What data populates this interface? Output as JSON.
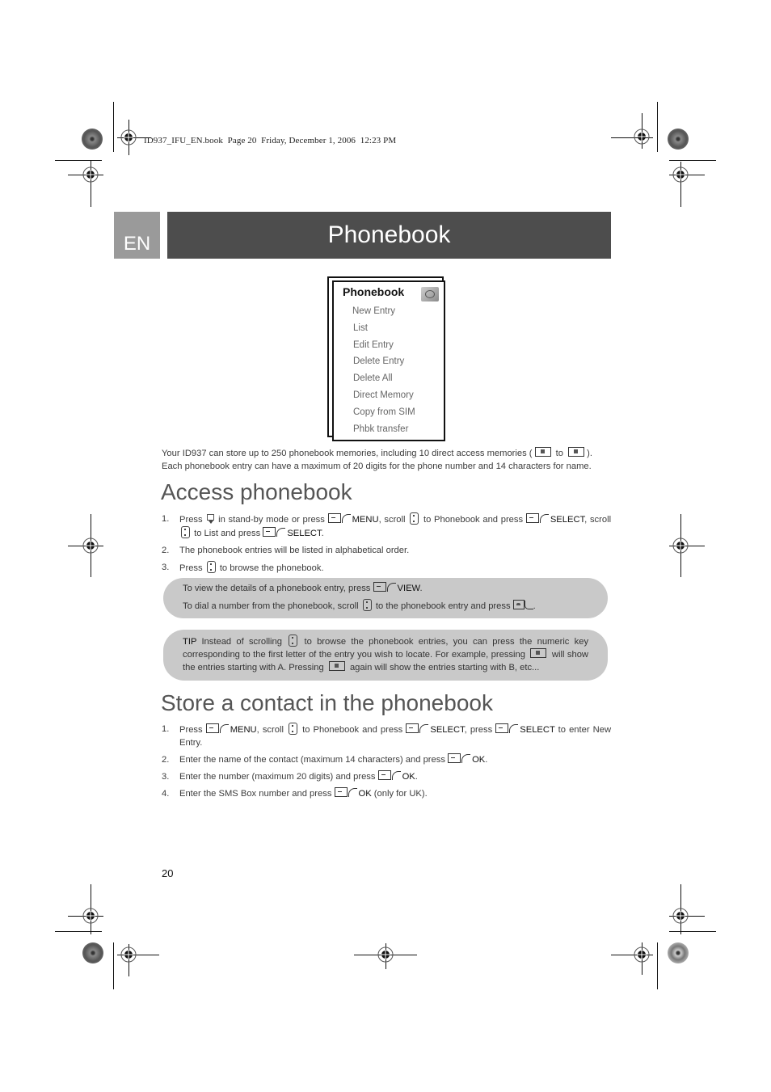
{
  "print_header": {
    "text": "ID937_IFU_EN.book  Page 20  Friday, December 1, 2006  12:23 PM"
  },
  "header": {
    "language_tab": "EN",
    "title": "Phonebook"
  },
  "phone_menu": {
    "title": "Phonebook",
    "icon": "phonebook-icon",
    "items": [
      "New Entry",
      "List",
      "Edit Entry",
      "Delete Entry",
      "Delete All",
      "Direct Memory",
      "Copy from SIM",
      "Phbk transfer"
    ]
  },
  "intro": {
    "line1_a": "Your ID937 can store up to 250 phonebook memories, including 10 direct access memories (",
    "line1_to": "to",
    "line1_b": ").",
    "line2": "Each phonebook entry can have a maximum of 20 digits for the phone number and 14 characters for name."
  },
  "access": {
    "heading": "Access phonebook",
    "steps": [
      {
        "num": "1.",
        "parts": {
          "a": "Press",
          "b": "in stand-by mode or press",
          "menu": "MENU",
          "c": ", scroll",
          "d": "to Phonebook and press",
          "select1": "SELECT",
          "e": ", scroll",
          "f": "to List and press",
          "select2": "SELECT",
          "g": "."
        }
      },
      {
        "num": "2.",
        "text": "The phonebook entries will be listed in alphabetical order."
      },
      {
        "num": "3.",
        "a": "Press",
        "b": "to browse the phonebook."
      }
    ],
    "note": {
      "line1_a": "To view the details of a phonebook entry, press",
      "line1_key": "VIEW",
      "line1_b": ".",
      "line2_a": "To dial a number from the phonebook, scroll",
      "line2_b": "to the phonebook entry and press",
      "line2_c": "."
    },
    "tip": {
      "label": "TIP",
      "a": "Instead of scrolling",
      "b": "to browse the phonebook entries, you can press the numeric key corresponding to the first letter of the entry you wish to locate. For example, pressing",
      "c": "will show the entries starting with A. Pressing",
      "d": "again will show the entries starting with B, etc..."
    }
  },
  "store": {
    "heading": "Store a contact in the phonebook",
    "steps": [
      {
        "num": "1.",
        "a": "Press",
        "menu": "MENU",
        "b": ", scroll",
        "c": "to Phonebook and press",
        "select1": "SELECT",
        "d": ", press",
        "select2": "SELECT",
        "e": "to enter New Entry."
      },
      {
        "num": "2.",
        "a": "Enter the name of the contact (maximum 14 characters) and press",
        "ok": "OK",
        "b": "."
      },
      {
        "num": "3.",
        "a": "Enter the number (maximum 20 digits) and press",
        "ok": "OK",
        "b": "."
      },
      {
        "num": "4.",
        "a": "Enter the SMS Box number and press",
        "ok": "OK",
        "b": " (only for UK)."
      }
    ]
  },
  "footer": {
    "page_number": "20"
  }
}
